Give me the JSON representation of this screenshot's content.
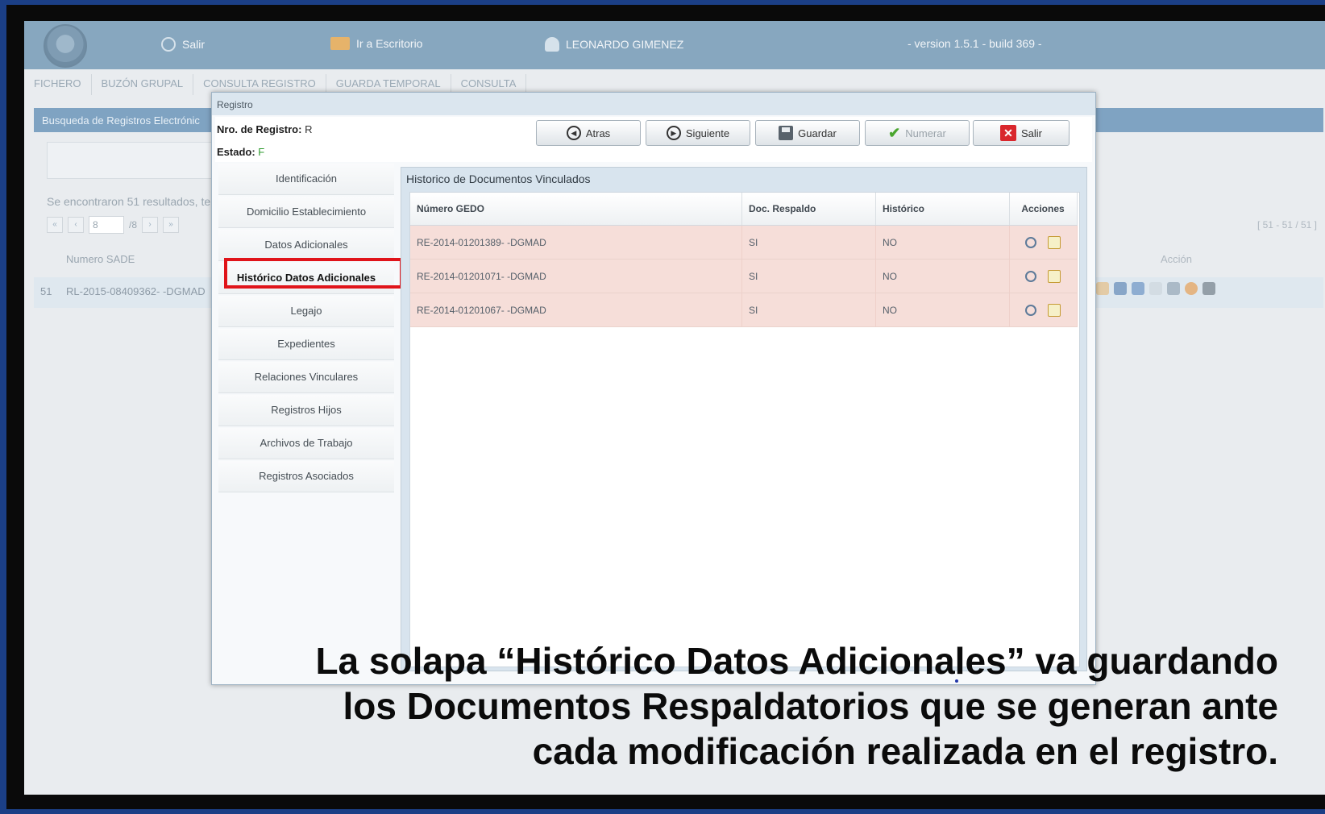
{
  "topbar": {
    "exit_label": "Salir",
    "desk_label": "Ir a Escritorio",
    "user_name": "LEONARDO GIMENEZ",
    "version": "- version 1.5.1 - build 369 -"
  },
  "main_tabs": [
    "FICHERO",
    "BUZÓN GRUPAL",
    "CONSULTA REGISTRO",
    "GUARDA TEMPORAL",
    "CONSULTA"
  ],
  "background": {
    "panel_title": "Busqueda de Registros Electrónic",
    "results_text": "Se encontraron 51 resultados, ter",
    "page_input": "8",
    "page_total": "/8",
    "column_numero": "Numero SADE",
    "row_index": "51",
    "row_numero": "RL-2015-08409362- -DGMAD",
    "range": "[ 51 - 51 / 51 ]",
    "accion_header": "Acción"
  },
  "dialog": {
    "title": "Registro",
    "nro_label": "Nro. de Registro:",
    "nro_value": "R",
    "estado_label": "Estado:",
    "estado_value": "F",
    "buttons": {
      "atras": "Atras",
      "siguiente": "Siguiente",
      "guardar": "Guardar",
      "numerar": "Numerar",
      "salir": "Salir"
    },
    "sidebar": [
      "Identificación",
      "Domicilio Establecimiento",
      "Datos Adicionales",
      "Histórico Datos Adicionales",
      "Legajo",
      "Expedientes",
      "Relaciones Vinculares",
      "Registros Hijos",
      "Archivos de Trabajo",
      "Registros Asociados"
    ],
    "panel_title": "Historico de Documentos Vinculados",
    "table": {
      "headers": [
        "Número GEDO",
        "Doc. Respaldo",
        "Histórico",
        "Acciones"
      ],
      "rows": [
        [
          "RE-2014-01201389- -DGMAD",
          "SI",
          "NO"
        ],
        [
          "RE-2014-01201071- -DGMAD",
          "SI",
          "NO"
        ],
        [
          "RE-2014-01201067- -DGMAD",
          "SI",
          "NO"
        ]
      ]
    }
  },
  "caption": {
    "line1": "La solapa “Histórico Datos Adicionales” va guardando",
    "line2": "los Documentos Respaldatorios que se generan ante",
    "line3": "cada modificación realizada en el registro."
  },
  "colors": {
    "topbar": "#87a7bf",
    "highlight": "#e0141a",
    "row_bg": "#f6ded9",
    "frame": "#1b3f86"
  }
}
